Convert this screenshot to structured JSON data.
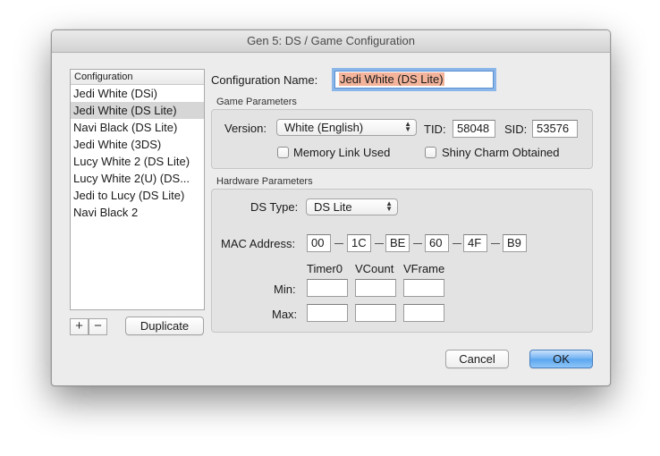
{
  "window": {
    "title": "Gen 5: DS / Game Configuration"
  },
  "sidebar": {
    "header": "Configuration",
    "items": [
      {
        "label": "Jedi White (DSi)",
        "selected": false
      },
      {
        "label": "Jedi White (DS Lite)",
        "selected": true
      },
      {
        "label": "Navi Black (DS Lite)",
        "selected": false
      },
      {
        "label": "Jedi White (3DS)",
        "selected": false
      },
      {
        "label": "Lucy White 2 (DS Lite)",
        "selected": false
      },
      {
        "label": "Lucy White 2(U) (DS...",
        "selected": false
      },
      {
        "label": "Jedi to Lucy (DS Lite)",
        "selected": false
      },
      {
        "label": "Navi Black 2",
        "selected": false
      }
    ],
    "add_label": "+",
    "remove_label": "−",
    "duplicate_label": "Duplicate"
  },
  "config_name": {
    "label": "Configuration Name:",
    "value": "Jedi White (DS Lite)"
  },
  "game_params": {
    "title": "Game Parameters",
    "version_label": "Version:",
    "version_value": "White (English)",
    "tid_label": "TID:",
    "tid_value": "58048",
    "sid_label": "SID:",
    "sid_value": "53576",
    "memory_link_label": "Memory Link Used",
    "memory_link_checked": false,
    "shiny_charm_label": "Shiny Charm Obtained",
    "shiny_charm_checked": false
  },
  "hardware_params": {
    "title": "Hardware Parameters",
    "ds_type_label": "DS Type:",
    "ds_type_value": "DS Lite",
    "mac_label": "MAC Address:",
    "mac": [
      "00",
      "1C",
      "BE",
      "60",
      "4F",
      "B9"
    ],
    "col_timer0": "Timer0",
    "col_vcount": "VCount",
    "col_vframe": "VFrame",
    "min_label": "Min:",
    "max_label": "Max:",
    "min_values": [
      "",
      "",
      ""
    ],
    "max_values": [
      "",
      "",
      ""
    ]
  },
  "footer": {
    "cancel_label": "Cancel",
    "ok_label": "OK"
  }
}
